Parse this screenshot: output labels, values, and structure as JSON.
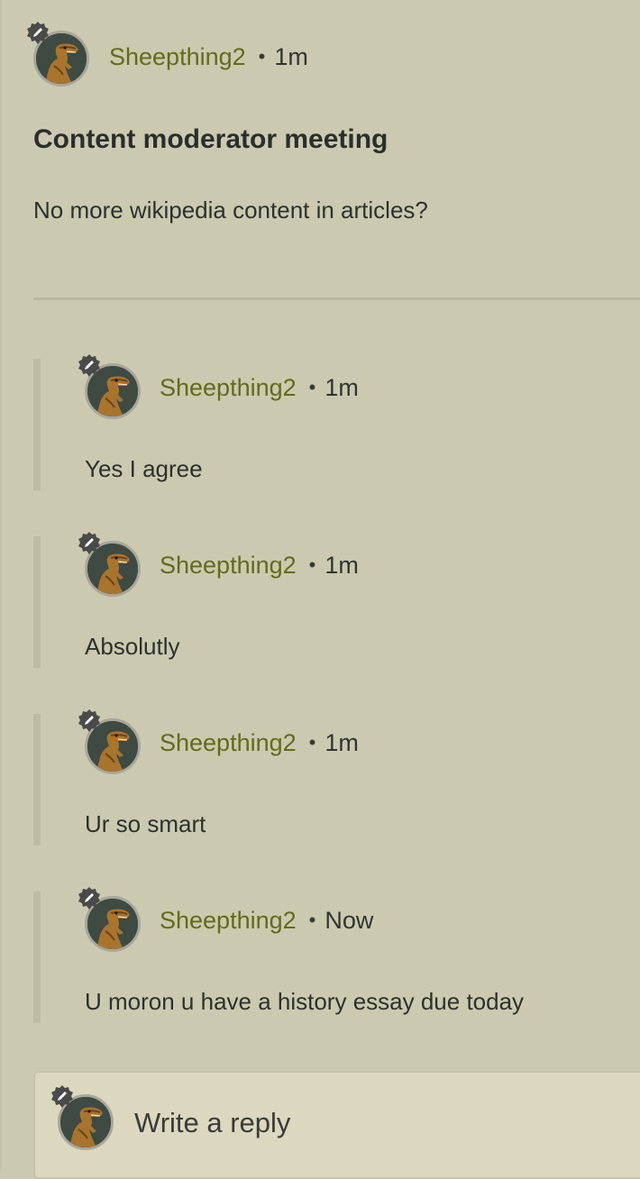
{
  "post": {
    "author": "Sheepthing2",
    "separator": "•",
    "time": "1m",
    "title": "Content moderator meeting",
    "body": "No more wikipedia content in articles?"
  },
  "comments": [
    {
      "author": "Sheepthing2",
      "separator": "•",
      "time": "1m",
      "text": "Yes I agree"
    },
    {
      "author": "Sheepthing2",
      "separator": "•",
      "time": "1m",
      "text": "Absolutly"
    },
    {
      "author": "Sheepthing2",
      "separator": "•",
      "time": "1m",
      "text": "Ur so smart"
    },
    {
      "author": "Sheepthing2",
      "separator": "•",
      "time": "Now",
      "text": "U moron u have a history essay due today"
    }
  ],
  "reply": {
    "placeholder": "Write a reply"
  },
  "icons": {
    "avatar": "dinosaur-avatar-icon",
    "badge": "moderator-pencil-badge-icon"
  },
  "colors": {
    "background": "#cbcab0",
    "username": "#636b1a",
    "reply_box": "#dcd8bf"
  }
}
